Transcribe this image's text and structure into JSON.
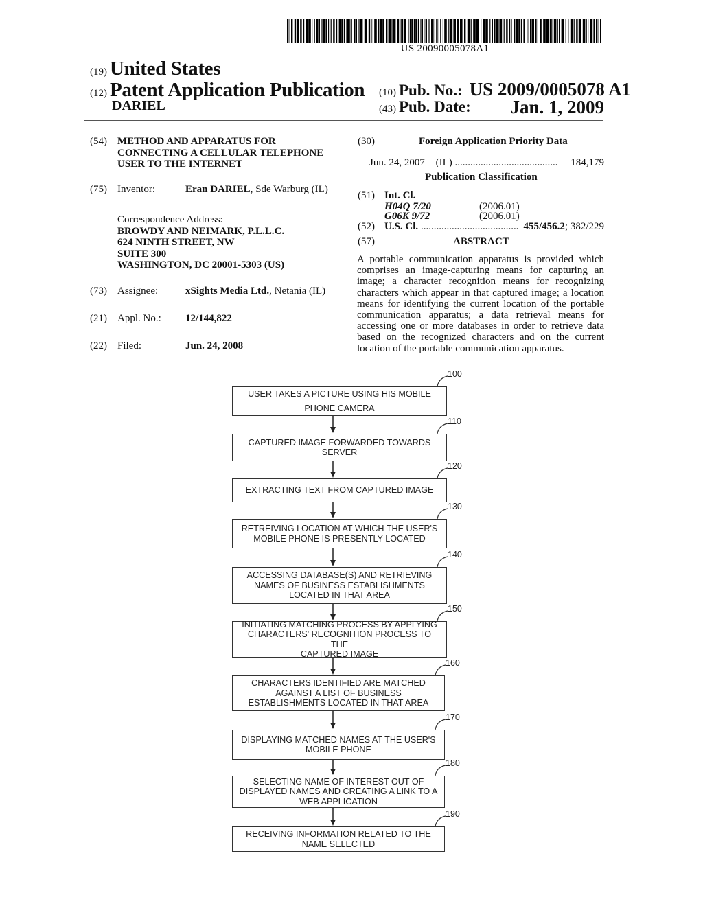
{
  "barcode": {
    "number": "US 20090005078A1"
  },
  "header": {
    "country_code": "(19)",
    "country": "United States",
    "type_code": "(12)",
    "type": "Patent Application Publication",
    "author": "DARIEL",
    "pub_no_code": "(10)",
    "pub_no_label": "Pub. No.:",
    "pub_no": "US 2009/0005078 A1",
    "pub_date_code": "(43)",
    "pub_date_label": "Pub. Date:",
    "pub_date": "Jan. 1, 2009"
  },
  "biblio": {
    "title_code": "(54)",
    "title_lines": [
      "METHOD AND APPARATUS FOR",
      "CONNECTING A CELLULAR TELEPHONE",
      "USER TO THE INTERNET"
    ],
    "inventor_code": "(75)",
    "inventor_label": "Inventor:",
    "inventor_name": "Eran DARIEL",
    "inventor_location": ", Sde Warburg (IL)",
    "correspondence_label": "Correspondence Address:",
    "correspondence_lines": [
      "BROWDY AND NEIMARK, P.L.L.C.",
      "624 NINTH STREET, NW",
      "SUITE 300",
      "WASHINGTON, DC 20001-5303 (US)"
    ],
    "assignee_code": "(73)",
    "assignee_label": "Assignee:",
    "assignee_name": "xSights Media Ltd.",
    "assignee_location": ", Netania (IL)",
    "appl_code": "(21)",
    "appl_label": "Appl. No.:",
    "appl_no": "12/144,822",
    "filed_code": "(22)",
    "filed_label": "Filed:",
    "filed_date": "Jun. 24, 2008"
  },
  "priority": {
    "code": "(30)",
    "heading": "Foreign Application Priority Data",
    "date": "Jun. 24, 2007",
    "country": "(IL)",
    "dots": "........................................",
    "number": "184,179"
  },
  "classification": {
    "heading": "Publication Classification",
    "int_code": "(51)",
    "int_label": "Int. Cl.",
    "int_classes": [
      {
        "cls": "H04Q 7/20",
        "ver": "(2006.01)"
      },
      {
        "cls": "G06K 9/72",
        "ver": "(2006.01)"
      }
    ],
    "us_code": "(52)",
    "us_label": "U.S. Cl.",
    "us_dots": "......................................",
    "us_primary": "455/456.2",
    "us_secondary": "; 382/229"
  },
  "abstract": {
    "code": "(57)",
    "heading": "ABSTRACT",
    "text": "A portable communication apparatus is provided which comprises an image-capturing means for capturing an image; a character recognition means for recognizing characters which appear in that captured image; a location means for identifying the current location of the portable communication apparatus; a data retrieval means for accessing one or more databases in order to retrieve data based on the recognized characters and on the current location of the portable communication apparatus."
  },
  "flowchart": {
    "steps": [
      {
        "ref": "100",
        "lines": [
          "USER TAKES A PICTURE USING HIS MOBILE",
          "PHONE CAMERA"
        ]
      },
      {
        "ref": "110",
        "lines": [
          "CAPTURED IMAGE FORWARDED TOWARDS",
          "SERVER"
        ]
      },
      {
        "ref": "120",
        "lines": [
          "EXTRACTING TEXT FROM CAPTURED IMAGE"
        ]
      },
      {
        "ref": "130",
        "lines": [
          "RETREIVING LOCATION AT WHICH THE USER'S",
          "MOBILE PHONE IS PRESENTLY LOCATED"
        ]
      },
      {
        "ref": "140",
        "lines": [
          "ACCESSING DATABASE(S) AND RETRIEVING",
          "NAMES OF BUSINESS ESTABLISHMENTS",
          "LOCATED IN THAT AREA"
        ]
      },
      {
        "ref": "150",
        "lines": [
          "INITIATING MATCHING PROCESS BY APPLYING",
          "CHARACTERS' RECOGNITION PROCESS TO THE",
          "CAPTURED IMAGE"
        ]
      },
      {
        "ref": "160",
        "lines": [
          "CHARACTERS IDENTIFIED ARE MATCHED",
          "AGAINST A LIST OF BUSINESS",
          "ESTABLISHMENTS LOCATED IN THAT AREA"
        ]
      },
      {
        "ref": "170",
        "lines": [
          "DISPLAYING MATCHED NAMES AT THE USER'S",
          "MOBILE PHONE"
        ]
      },
      {
        "ref": "180",
        "lines": [
          "SELECTING NAME OF INTEREST OUT OF",
          "DISPLAYED NAMES AND CREATING A LINK TO A",
          "WEB APPLICATION"
        ]
      },
      {
        "ref": "190",
        "lines": [
          "RECEIVING INFORMATION RELATED TO THE",
          "NAME SELECTED"
        ]
      }
    ]
  }
}
